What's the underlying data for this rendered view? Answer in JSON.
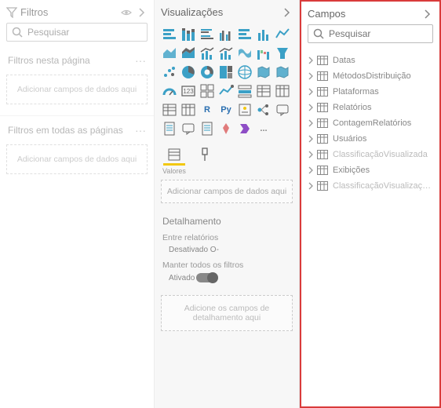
{
  "filters": {
    "title": "Filtros",
    "search_placeholder": "Pesquisar",
    "section_page": "Filtros nesta página",
    "drop_page": "Adicionar campos de dados aqui",
    "section_all": "Filtros em todas as páginas",
    "drop_all": "Adicionar campos de dados aqui"
  },
  "viz": {
    "title": "Visualizações",
    "letters": {
      "r": "R",
      "py": "Py",
      "ellipsis": "..."
    },
    "values_label": "Valores",
    "drop_values": "Adicionar campos de dados aqui",
    "drill_title": "Detalhamento",
    "cross_report": "Entre relatórios",
    "off_label": "Desativado O-",
    "keep_filters": "Manter todos os filtros",
    "on_label": "Ativado",
    "drop_drill": "Adicione os campos de detalhamento aqui"
  },
  "fields": {
    "title": "Campos",
    "search_placeholder": "Pesquisar",
    "tables": [
      {
        "name": "Datas",
        "dim": false
      },
      {
        "name": "MétodosDistribuição",
        "dim": false
      },
      {
        "name": "Plataformas",
        "dim": false
      },
      {
        "name": "Relatórios",
        "dim": false
      },
      {
        "name": "ContagemRelatórios",
        "dim": false
      },
      {
        "name": "Usuários",
        "dim": false
      },
      {
        "name": "ClassificaçãoVisualizada",
        "dim": true
      },
      {
        "name": "Exibições",
        "dim": false
      },
      {
        "name": "ClassificaçãoVisualizações",
        "dim": true
      }
    ]
  }
}
